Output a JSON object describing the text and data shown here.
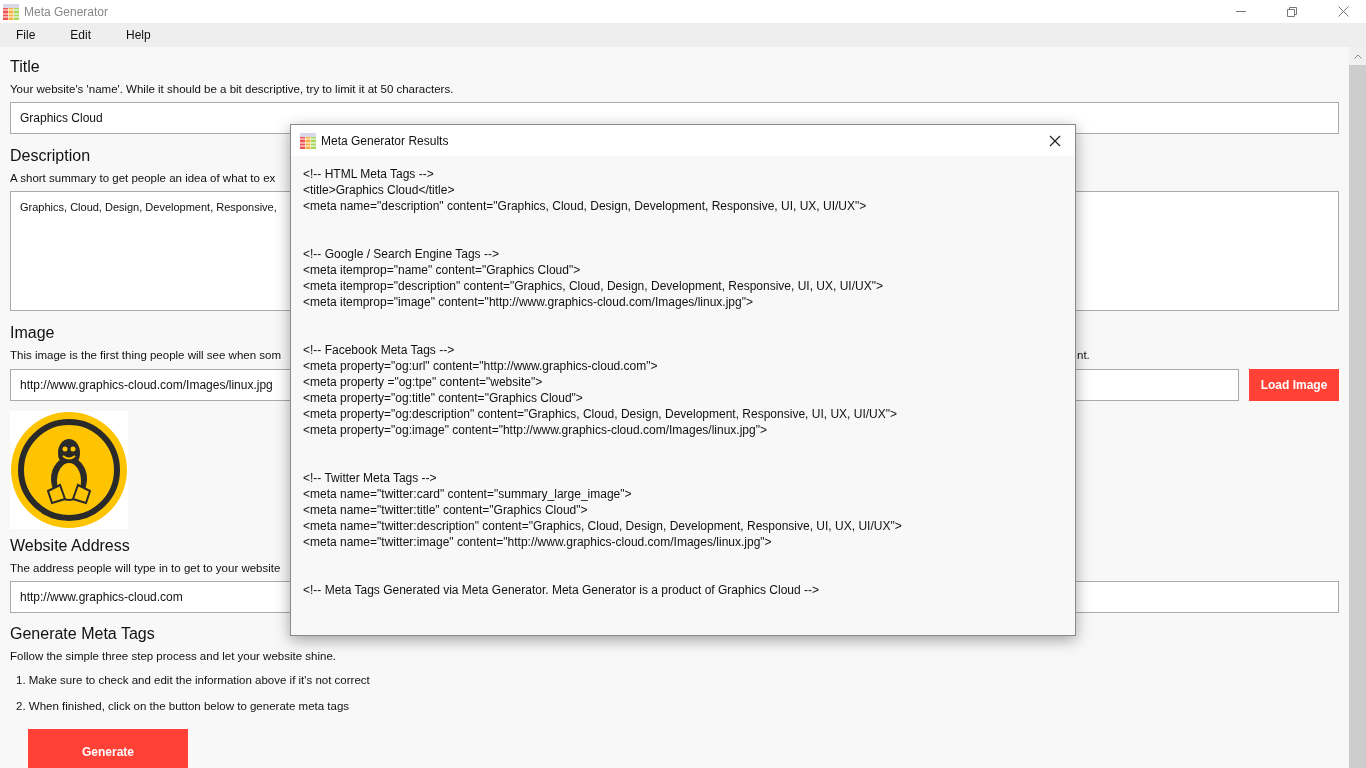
{
  "window": {
    "title": "Meta Generator"
  },
  "menu": [
    "File",
    "Edit",
    "Help"
  ],
  "sections": [
    {
      "kind": "input",
      "heading": "Title",
      "hint": "Your website's 'name'. While it should be a bit descriptive, try to limit it at 50 characters.",
      "value": "Graphics Cloud"
    },
    {
      "kind": "textarea",
      "heading": "Description",
      "hint": "A short summary to get people an idea of what to ex",
      "value": "Graphics, Cloud, Design, Development, Responsive,"
    },
    {
      "kind": "image",
      "heading": "Image",
      "hint": "This image is the first thing people will see when som",
      "hint_end": "nt.",
      "value": "http://www.graphics-cloud.com/Images/linux.jpg",
      "button": "Load Image"
    },
    {
      "kind": "input",
      "heading": "Website Address",
      "hint": "The address people will type in to get to your website",
      "value": "http://www.graphics-cloud.com"
    }
  ],
  "generate": {
    "heading": "Generate Meta Tags",
    "intro": "Follow the simple three step process and let your website shine.",
    "steps": [
      "1. Make sure to check and edit the information above if it's not correct",
      "2. When finished, click on the button below to generate meta tags"
    ],
    "button": "Generate"
  },
  "dialog": {
    "title": "Meta Generator Results",
    "sections": [
      [
        "<!-- HTML Meta Tags -->",
        "<title>Graphics Cloud</title>",
        "<meta name=\"description\" content=\"Graphics, Cloud, Design, Development, Responsive, UI, UX, UI/UX\">"
      ],
      [
        "<!-- Google / Search Engine Tags -->",
        "<meta itemprop=\"name\" content=\"Graphics Cloud\">",
        "<meta itemprop=\"description\" content=\"Graphics, Cloud, Design, Development, Responsive, UI, UX, UI/UX\">",
        "<meta itemprop=\"image\" content=\"http://www.graphics-cloud.com/Images/linux.jpg\">"
      ],
      [
        "<!-- Facebook Meta Tags -->",
        "<meta property=\"og:url\" content=\"http://www.graphics-cloud.com\">",
        "<meta property =\"og:tpe\" content=\"website\">",
        "<meta property=\"og:title\" content=\"Graphics Cloud\">",
        "<meta property=\"og:description\" content=\"Graphics, Cloud, Design, Development, Responsive, UI, UX, UI/UX\">",
        "<meta property=\"og:image\" content=\"http://www.graphics-cloud.com/Images/linux.jpg\">"
      ],
      [
        "<!-- Twitter Meta Tags -->",
        "<meta name=\"twitter:card\" content=\"summary_large_image\">",
        "<meta name=\"twitter:title\" content=\"Graphics Cloud\">",
        "<meta name=\"twitter:description\" content=\"Graphics, Cloud, Design, Development, Responsive, UI, UX, UI/UX\">",
        "<meta name=\"twitter:image\" content=\"http://www.graphics-cloud.com/Images/linux.jpg\">"
      ],
      [
        "<!-- Meta Tags Generated via Meta Generator. Meta Generator is a product of Graphics Cloud -->"
      ]
    ]
  }
}
